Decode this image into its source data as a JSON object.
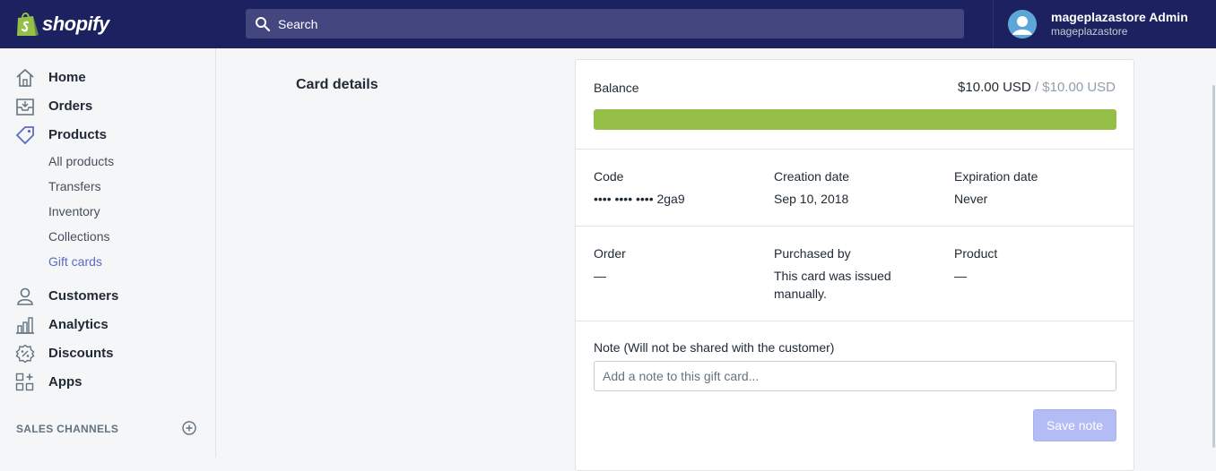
{
  "app": {
    "brand": "shopify"
  },
  "search": {
    "placeholder": "Search"
  },
  "user": {
    "name": "mageplazastore Admin",
    "store": "mageplazastore"
  },
  "sidebar": {
    "items": [
      {
        "label": "Home",
        "icon": "home-icon"
      },
      {
        "label": "Orders",
        "icon": "orders-icon"
      },
      {
        "label": "Products",
        "icon": "tag-icon"
      },
      {
        "label": "Customers",
        "icon": "person-icon"
      },
      {
        "label": "Analytics",
        "icon": "chart-icon"
      },
      {
        "label": "Discounts",
        "icon": "discount-icon"
      },
      {
        "label": "Apps",
        "icon": "apps-icon"
      }
    ],
    "products_sub": [
      "All products",
      "Transfers",
      "Inventory",
      "Collections",
      "Gift cards"
    ],
    "active_sub": "Gift cards",
    "section_label": "SALES CHANNELS"
  },
  "main": {
    "section_title": "Card details",
    "balance": {
      "label": "Balance",
      "current": "$10.00 USD",
      "separator": "/",
      "initial": "$10.00 USD",
      "fraction": 1.0
    },
    "code": {
      "label": "Code",
      "value": "•••• •••• •••• 2ga9"
    },
    "creation": {
      "label": "Creation date",
      "value": "Sep 10, 2018"
    },
    "expiration": {
      "label": "Expiration date",
      "value": "Never"
    },
    "order": {
      "label": "Order",
      "value": "—"
    },
    "purchased_by": {
      "label": "Purchased by",
      "value": "This card was issued manually."
    },
    "product": {
      "label": "Product",
      "value": "—"
    },
    "note": {
      "label": "Note (Will not be shared with the customer)",
      "placeholder": "Add a note to this gift card..."
    },
    "save_label": "Save note"
  },
  "colors": {
    "topbar": "#1c2260",
    "accent": "#5c6ac4",
    "balance_bar": "#96bf48"
  }
}
